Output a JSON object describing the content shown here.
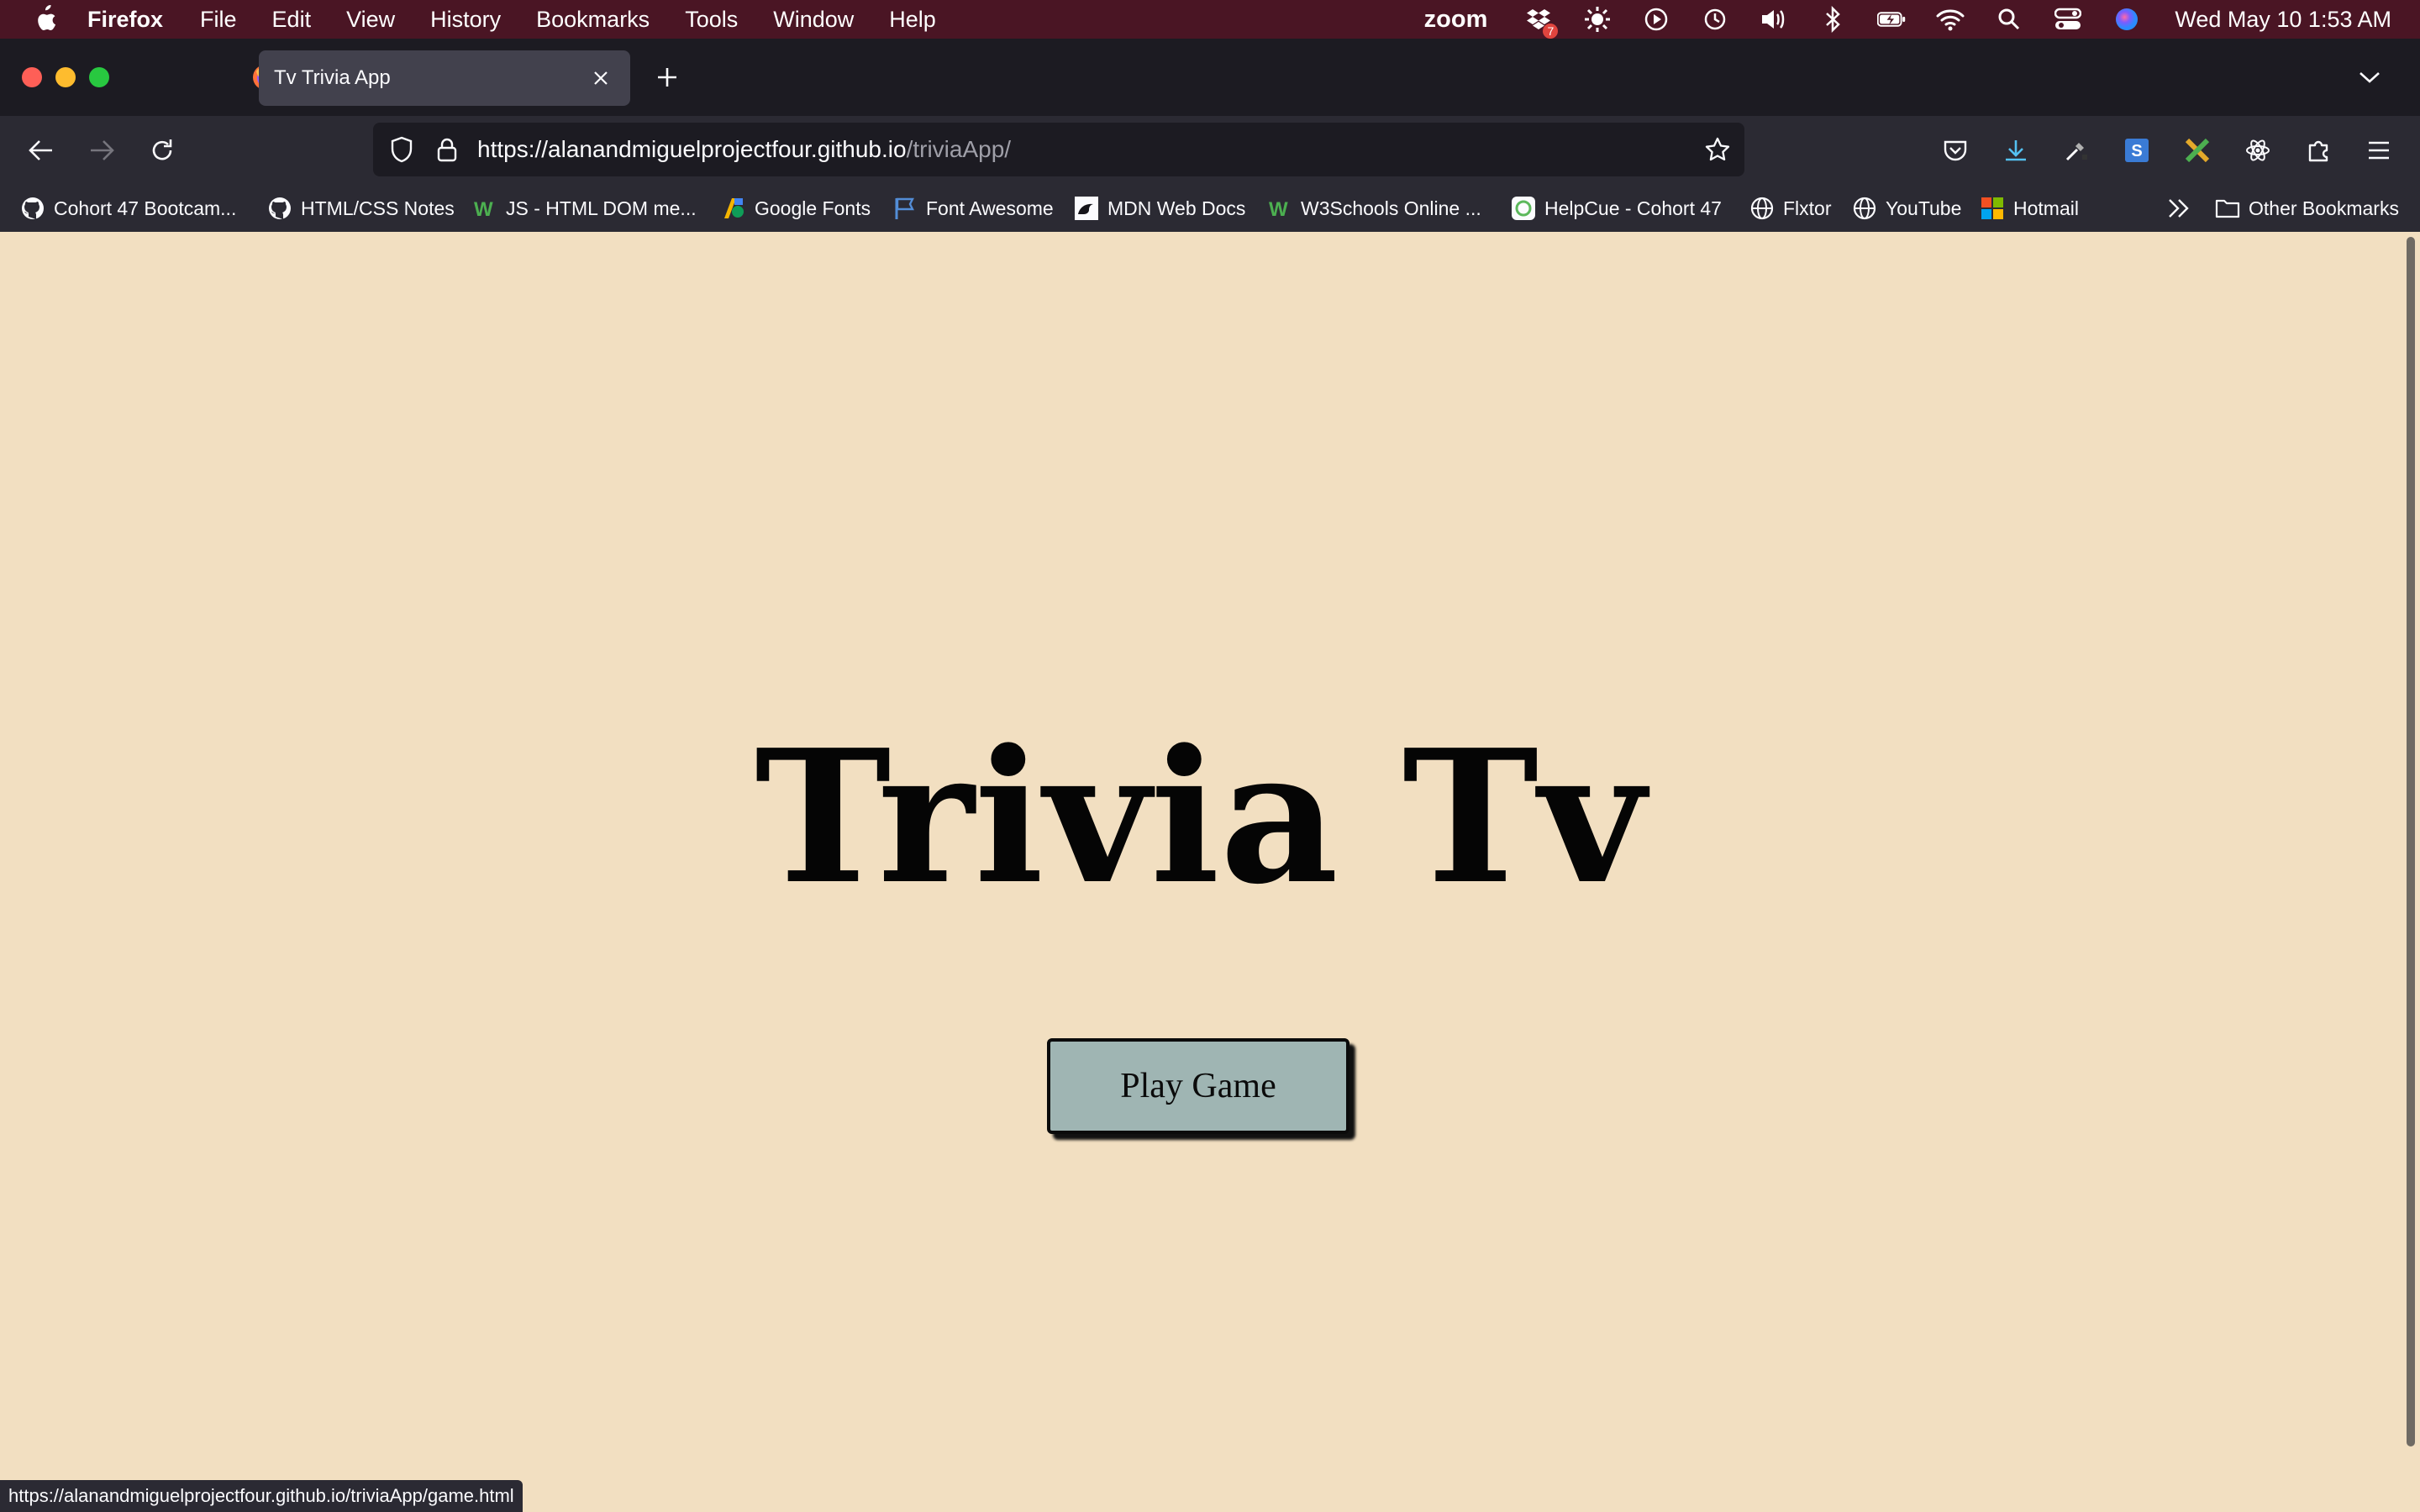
{
  "menubar": {
    "app_name": "Firefox",
    "menus": [
      "File",
      "Edit",
      "View",
      "History",
      "Bookmarks",
      "Tools",
      "Window",
      "Help"
    ],
    "zoom_label": "zoom",
    "badge_count": "7",
    "clock": "Wed May 10  1:53 AM"
  },
  "browser": {
    "tab_title": "Tv Trivia App",
    "url_host": "https://alanandmiguelprojectfour.github.io",
    "url_path": "/triviaApp/",
    "bookmarks": [
      "Cohort 47 Bootcam...",
      "HTML/CSS Notes",
      "JS - HTML DOM me...",
      "Google Fonts",
      "Font Awesome",
      "MDN Web Docs",
      "W3Schools Online ...",
      "HelpCue - Cohort 47",
      "Flxtor",
      "YouTube",
      "Hotmail"
    ],
    "other_bookmarks": "Other Bookmarks",
    "status_url": "https://alanandmiguelprojectfour.github.io/triviaApp/game.html"
  },
  "page": {
    "title": "Trivia Tv",
    "play_button": "Play Game",
    "background": "#f2dfc1",
    "button_color": "#9fb5b3"
  }
}
